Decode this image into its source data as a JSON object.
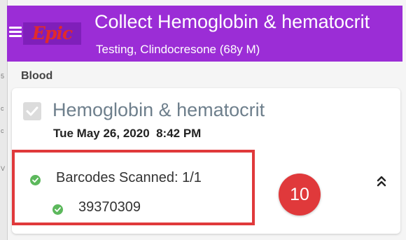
{
  "header": {
    "logo_text": "Epic",
    "title": "Collect Hemoglobin & hematocrit",
    "patient": "Testing, Clindocresone (68y M)"
  },
  "section": {
    "label": "Blood"
  },
  "order": {
    "name": "Hemoglobin & hematocrit",
    "datetime": "Tue May 26, 2020  8:42 PM",
    "checked": true
  },
  "barcodes": {
    "summary": "Barcodes Scanned: 1/1",
    "items": [
      "39370309"
    ]
  },
  "annotation": {
    "step_number": "10"
  },
  "colors": {
    "header_bg": "#9b2dd6",
    "highlight_red": "#e0393b",
    "success_green": "#5cb85c"
  },
  "icons": {
    "menu": "hamburger-menu-icon",
    "check": "check-circle-icon",
    "collapse": "double-chevron-up-icon",
    "checkbox": "checkbox-checked-icon"
  }
}
